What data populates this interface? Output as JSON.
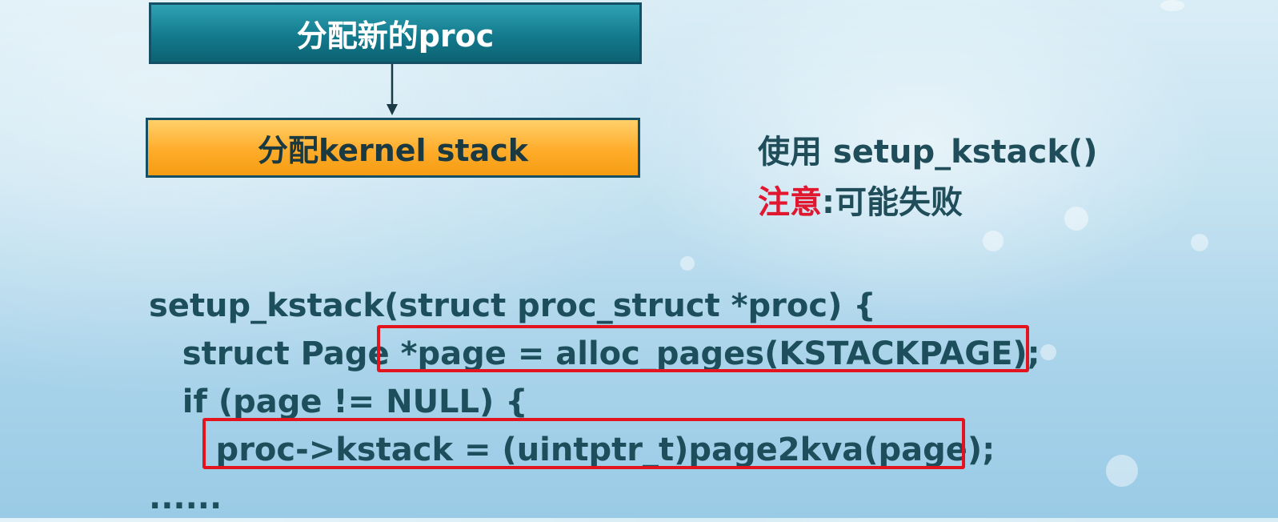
{
  "flowchart": {
    "step1_label": "分配新的proc",
    "step2_label": "分配kernel stack"
  },
  "notes": {
    "usage": "使用 setup_kstack()",
    "warning_label": "注意",
    "warning_text": ":可能失败"
  },
  "code": {
    "lines": [
      "setup_kstack(struct proc_struct *proc) {",
      "   struct Page *page = alloc_pages(KSTACKPAGE);",
      "   if (page != NULL) {",
      "      proc->kstack = (uintptr_t)page2kva(page);",
      "......"
    ]
  },
  "colors": {
    "step1_fill": "#137a8d",
    "step2_fill": "#ffac2a",
    "highlight": "#e4141f",
    "warning_text": "#e0172f"
  }
}
